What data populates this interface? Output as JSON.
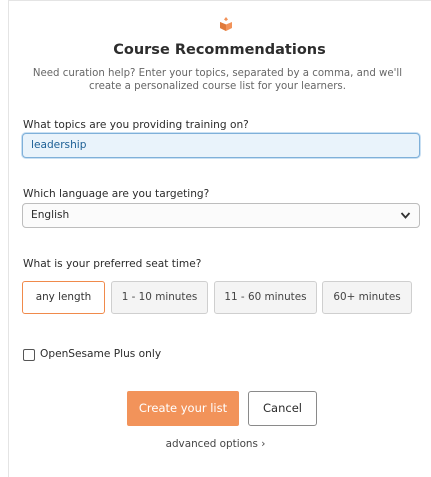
{
  "header": {
    "logo_icon": "opensesame-logo-icon",
    "brand_color": "#f2935a",
    "title": "Course Recommendations",
    "subtitle": "Need curation help? Enter your topics, separated by a comma, and we'll create a personalized course list for your learners."
  },
  "topics": {
    "label": "What topics are you providing training on?",
    "value": "leadership"
  },
  "language": {
    "label": "Which language are you targeting?",
    "selected": "English",
    "icon": "chevron-down-icon"
  },
  "seat_time": {
    "label": "What is your preferred seat time?",
    "options": [
      "any length",
      "1 - 10 minutes",
      "11 - 60 minutes",
      "60+ minutes"
    ],
    "selected": "any length"
  },
  "plus_only": {
    "label": "OpenSesame Plus only",
    "checked": false
  },
  "actions": {
    "create": "Create your list",
    "cancel": "Cancel",
    "advanced": "advanced options ›"
  }
}
